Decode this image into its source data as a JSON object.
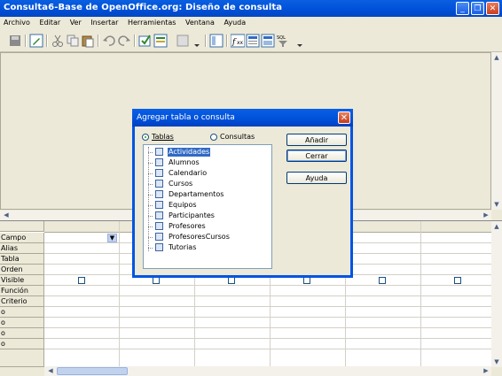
{
  "window": {
    "title": "Consulta6-Base de OpenOffice.org: Diseño de consulta"
  },
  "menu": [
    "Archivo",
    "Editar",
    "Ver",
    "Insertar",
    "Herramientas",
    "Ventana",
    "Ayuda"
  ],
  "toolbar_icons": [
    "save-icon",
    "edit-icon",
    "cut-icon",
    "copy-icon",
    "paste-icon",
    "undo-icon",
    "redo-icon",
    "run-query-icon",
    "clear-query-icon",
    "design-view-icon",
    "add-table-icon",
    "functions-icon",
    "table-name-icon",
    "alias-icon",
    "distinct-values-icon"
  ],
  "grid": {
    "rows": [
      "Campo",
      "Alias",
      "Tabla",
      "Orden",
      "Visible",
      "Función",
      "Criterio",
      "o",
      "o",
      "o",
      "o"
    ]
  },
  "dialog": {
    "title": "Agregar tabla o consulta",
    "radio_tables": "Tablas",
    "radio_queries": "Consultas",
    "items": [
      "Actividades",
      "Alumnos",
      "Calendario",
      "Cursos",
      "Departamentos",
      "Equipos",
      "Participantes",
      "Profesores",
      "ProfesoresCursos",
      "Tutorias"
    ],
    "selected_item": "Actividades",
    "buttons": {
      "add": "Añadir",
      "close": "Cerrar",
      "help": "Ayuda"
    }
  },
  "colors": {
    "titlebar": "#0054e3",
    "selection": "#316ac5",
    "face": "#ece9d8"
  }
}
